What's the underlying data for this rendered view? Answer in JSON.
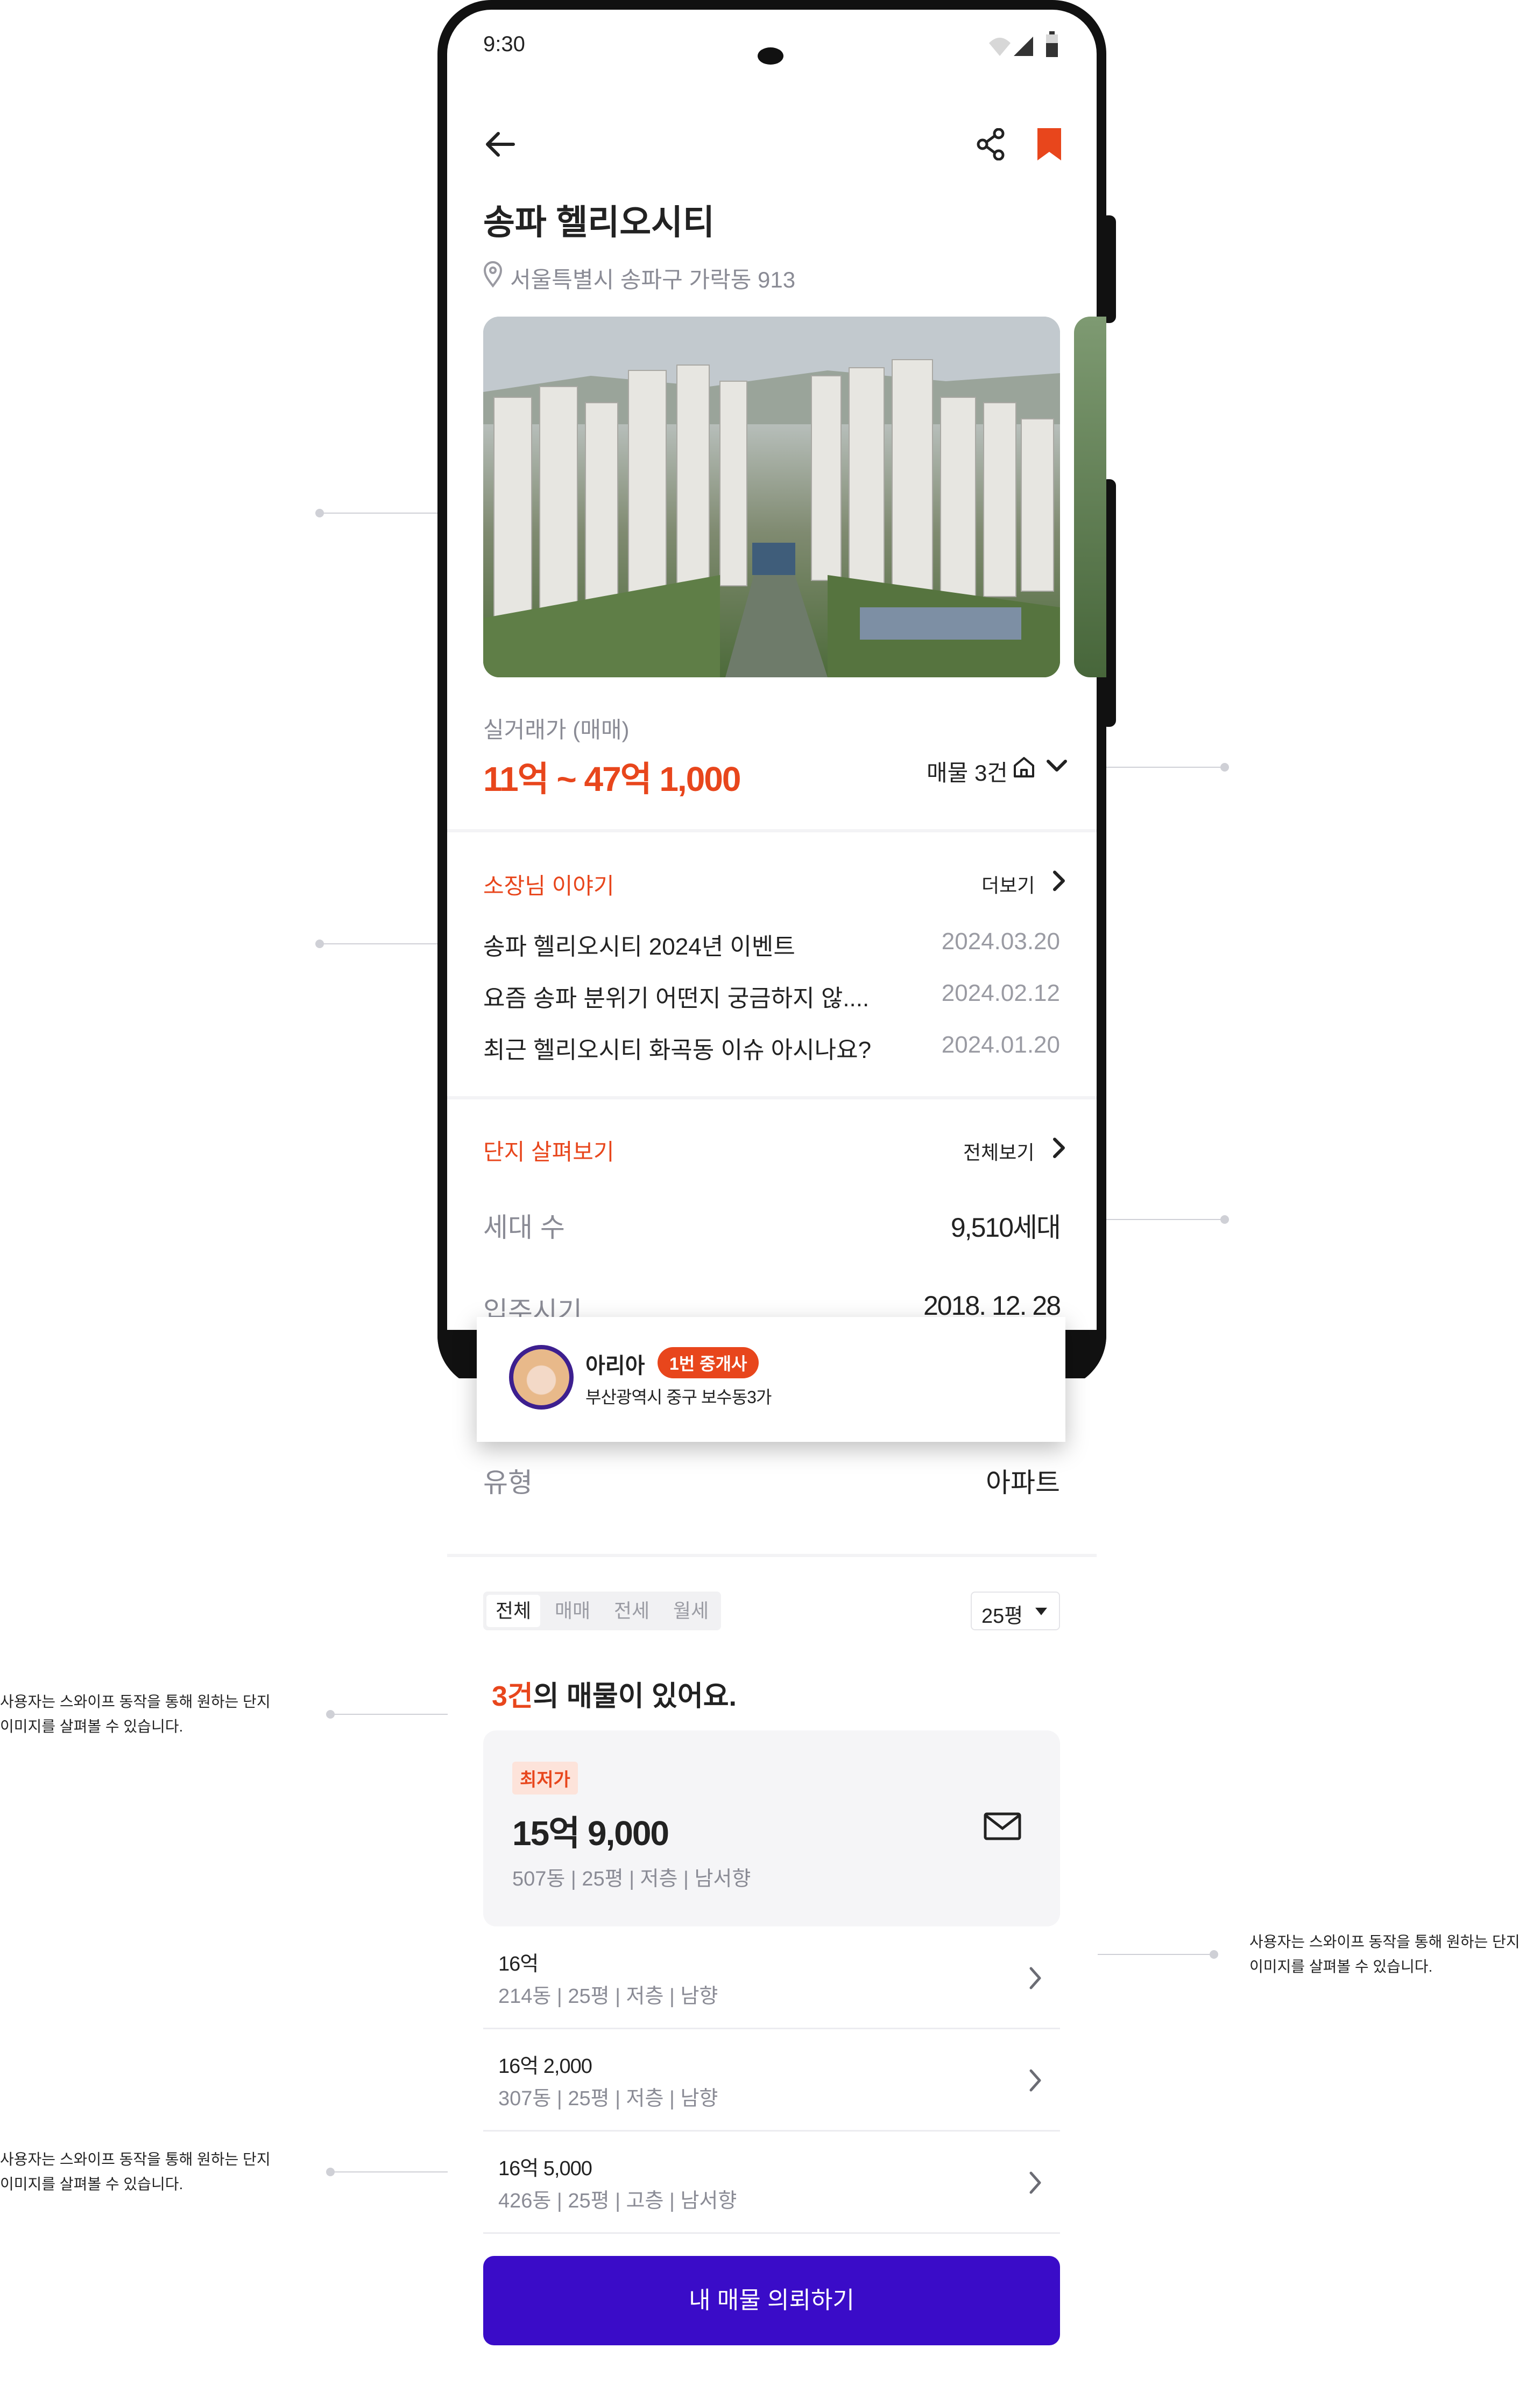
{
  "status_bar": {
    "time": "9:30"
  },
  "header": {
    "title": "송파 헬리오시티",
    "address": "서울특별시 송파구 가락동 913"
  },
  "price": {
    "label": "실거래가 (매매)",
    "range": "11억 ~ 47억 1,000",
    "listing_count": "매물 3건"
  },
  "story": {
    "title": "소장님 이야기",
    "more": "더보기",
    "items": [
      {
        "text": "송파 헬리오시티 2024년 이벤트",
        "date": "2024.03.20"
      },
      {
        "text": "요즘 송파 분위기 어떤지 궁금하지 않....",
        "date": "2024.02.12"
      },
      {
        "text": "최근 헬리오시티 화곡동 이슈 아시나요?",
        "date": "2024.01.20"
      }
    ]
  },
  "complex": {
    "title": "단지 살펴보기",
    "more": "전체보기",
    "rows": [
      {
        "label": "세대 수",
        "value": "9,510세대"
      },
      {
        "label": "입주시기",
        "value": "2018. 12. 28"
      },
      {
        "label": "유형",
        "value": "아파트"
      }
    ]
  },
  "agent": {
    "name": "아리아",
    "badge": "1번 중개사",
    "address": "부산광역시 중구 보수동3가"
  },
  "filters": {
    "tabs": [
      "전체",
      "매매",
      "전세",
      "월세"
    ],
    "size": "25평"
  },
  "listings": {
    "headline_count": "3건",
    "headline_rest": "의 매물이 있어요.",
    "featured": {
      "badge": "최저가",
      "price": "15억 9,000",
      "detail": "507동 | 25평 | 저층 | 남서향"
    },
    "items": [
      {
        "price": "16억",
        "detail": "214동 | 25평 | 저층 | 남향"
      },
      {
        "price": "16억 2,000",
        "detail": "307동 | 25평 | 저층 | 남향"
      },
      {
        "price": "16억 5,000",
        "detail": "426동 | 25평 | 고층 | 남서향"
      }
    ]
  },
  "cta": {
    "label": "내 매물 의뢰하기"
  },
  "notes": {
    "n1_line1": "사용자는 스와이프 동작을 통해 원하는 단지",
    "n1_line2": "이미지를 살펴볼 수 있습니다.",
    "n2_line1": "사용자는 스와이프 동작을 통해 원하는 단지",
    "n2_line2": "이미지를 살펴볼 수 있습니다.",
    "n3_line1": "사용자는 스와이프 동작을 통해 원하는 단지",
    "n3_line2": "이미지를 살펴볼 수 있습니다."
  },
  "colors": {
    "accent": "#e8461c",
    "cta": "#3a0cc8",
    "text": "#222222",
    "muted": "#8a8b95"
  },
  "icons": [
    "back-arrow-icon",
    "share-icon",
    "bookmark-icon",
    "location-pin-icon",
    "house-icon",
    "chevron-down-icon",
    "chevron-right-icon",
    "mail-icon",
    "caret-down-icon",
    "wifi-icon",
    "signal-icon",
    "battery-icon"
  ]
}
